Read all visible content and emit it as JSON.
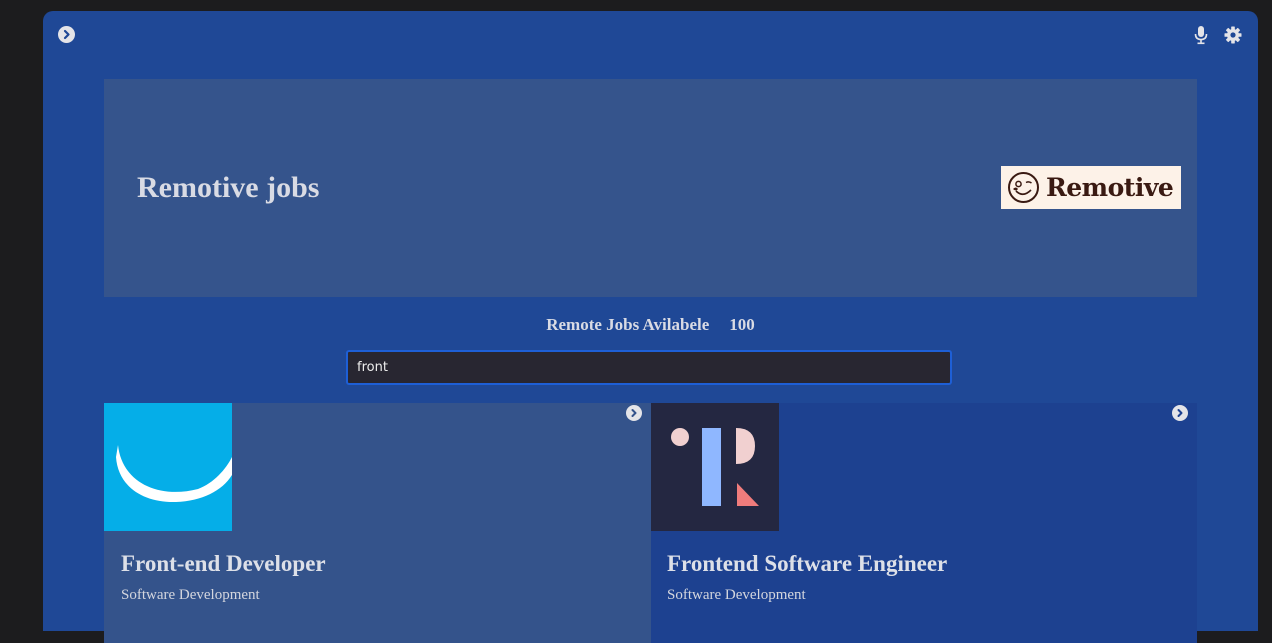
{
  "app": {
    "title": "Remotive jobs",
    "logo_text": "Remotive"
  },
  "stats": {
    "label": "Remote Jobs Avilabele",
    "count": "100"
  },
  "search": {
    "value": "front"
  },
  "jobs": [
    {
      "title": "Front-end Developer",
      "category": "Software Development",
      "logo_icon": "smile-arc-logo-icon"
    },
    {
      "title": "Frontend Software Engineer",
      "category": "Software Development",
      "logo_icon": "letter-r-shapes-logo-icon"
    }
  ],
  "icons": {
    "expand": "chevron-right-circle-icon",
    "voice": "microphone-icon",
    "settings": "gear-icon"
  },
  "colors": {
    "app_background": "#1f4896",
    "hero_background": "#35548c",
    "search_border": "#1e5fd6",
    "logo_background": "#fdf2e8"
  }
}
